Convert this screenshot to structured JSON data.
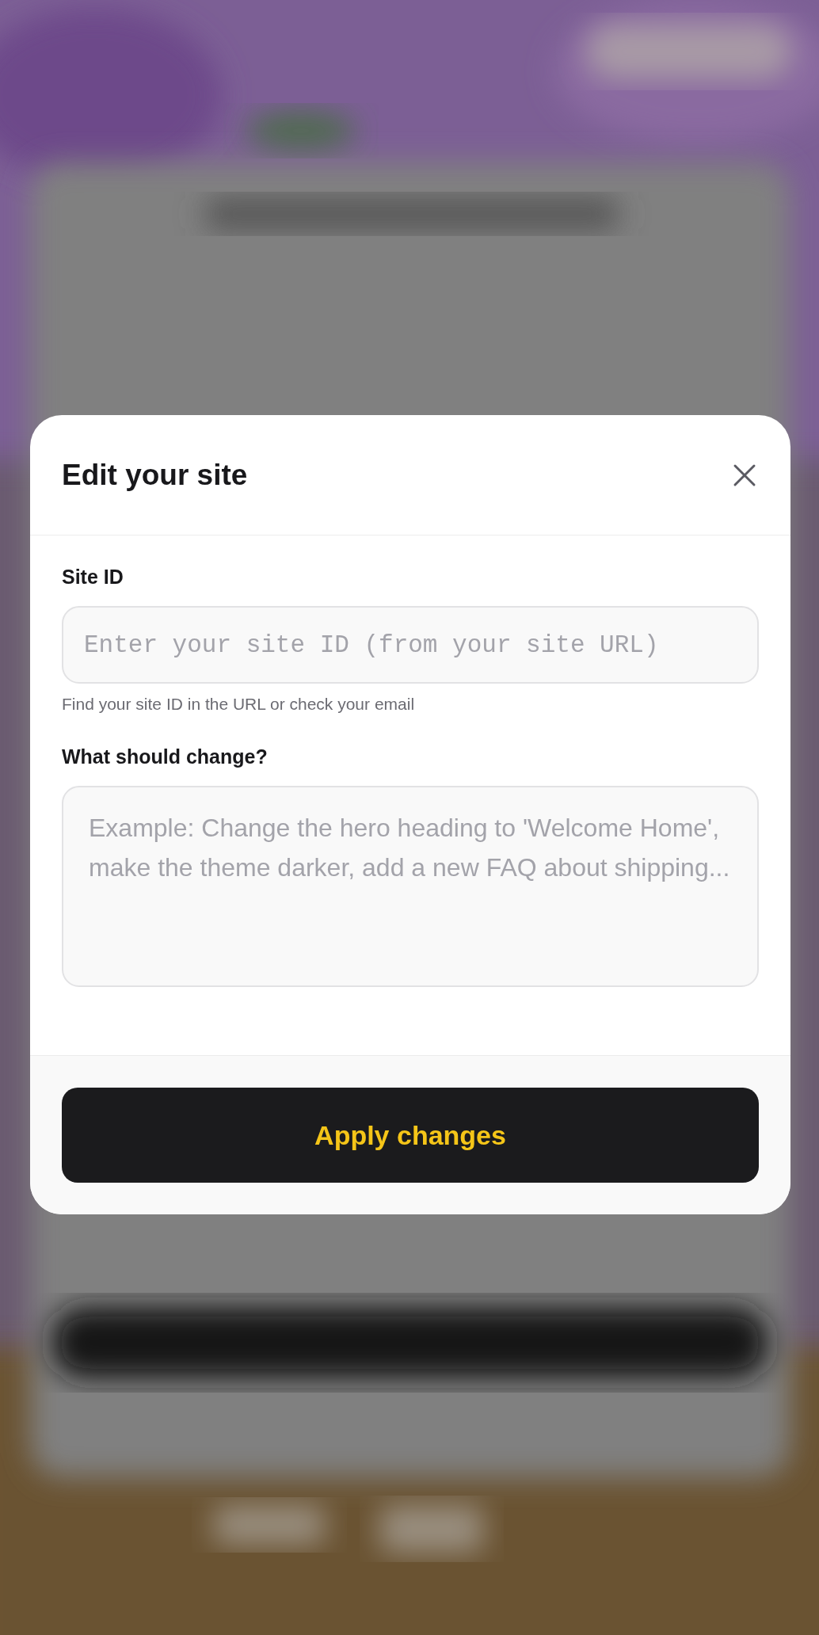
{
  "dialog": {
    "title": "Edit your site",
    "fields": [
      {
        "kind": "input",
        "label": "Site ID",
        "placeholder": "Enter your site ID (from your site URL)",
        "hint": "Find your site ID in the URL or check your email"
      },
      {
        "kind": "textarea",
        "label": "What should change?",
        "placeholder": "Example: Change the hero heading to 'Welcome Home', make the theme darker, add a new FAQ about shipping..."
      }
    ],
    "submit": "Apply changes"
  }
}
